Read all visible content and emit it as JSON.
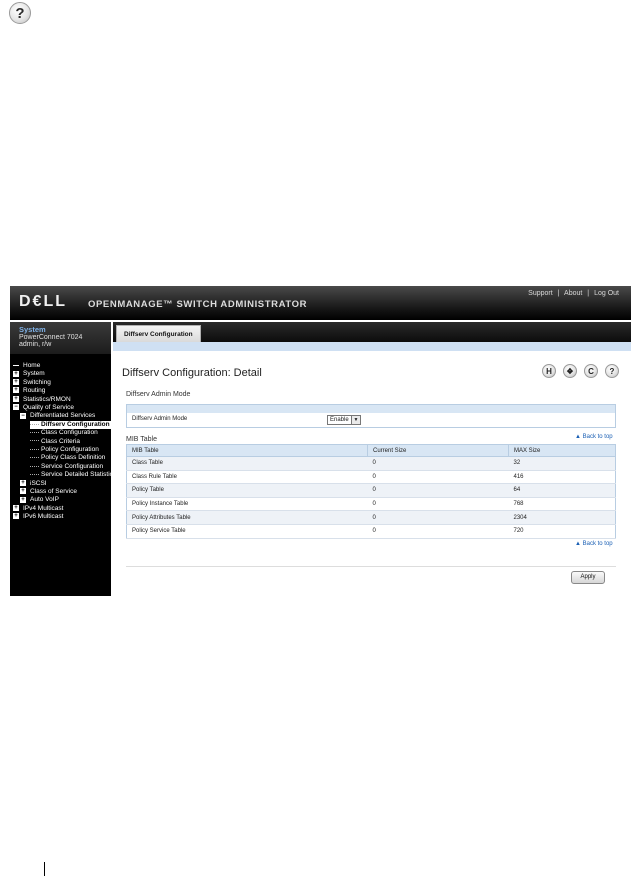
{
  "help_top": {
    "glyph": "?"
  },
  "banner": {
    "logo": "D€LL",
    "product": "OPENMANAGE™ SWITCH ADMINISTRATOR",
    "links": [
      "Support",
      "About",
      "Log Out"
    ],
    "sep": "|"
  },
  "sidebar": {
    "system_title": "System",
    "system_model": "PowerConnect 7024",
    "system_user": "admin, r/w",
    "tree": [
      {
        "label": "Home",
        "depth": 0,
        "mark": "none"
      },
      {
        "label": "System",
        "depth": 0,
        "mark": "plus"
      },
      {
        "label": "Switching",
        "depth": 0,
        "mark": "plus"
      },
      {
        "label": "Routing",
        "depth": 0,
        "mark": "plus"
      },
      {
        "label": "Statistics/RMON",
        "depth": 0,
        "mark": "plus"
      },
      {
        "label": "Quality of Service",
        "depth": 0,
        "mark": "minus"
      },
      {
        "label": "Differentiated Services",
        "depth": 1,
        "mark": "minus"
      },
      {
        "label": "Diffserv Configuration",
        "depth": 2,
        "mark": "none",
        "selected": true
      },
      {
        "label": "Class Configuration",
        "depth": 2,
        "mark": "none"
      },
      {
        "label": "Class Criteria",
        "depth": 2,
        "mark": "none"
      },
      {
        "label": "Policy Configuration",
        "depth": 2,
        "mark": "none"
      },
      {
        "label": "Policy Class Definition",
        "depth": 2,
        "mark": "none"
      },
      {
        "label": "Service Configuration",
        "depth": 2,
        "mark": "none"
      },
      {
        "label": "Service Detailed Statistics",
        "depth": 2,
        "mark": "none"
      },
      {
        "label": "iSCSI",
        "depth": 1,
        "mark": "plus"
      },
      {
        "label": "Class of Service",
        "depth": 1,
        "mark": "plus"
      },
      {
        "label": "Auto VoIP",
        "depth": 1,
        "mark": "plus"
      },
      {
        "label": "IPv4 Multicast",
        "depth": 0,
        "mark": "plus"
      },
      {
        "label": "IPv6 Multicast",
        "depth": 0,
        "mark": "plus"
      }
    ]
  },
  "main": {
    "tab_label": "Diffserv Configuration",
    "page_title": "Diffserv Configuration: Detail",
    "icons": [
      {
        "name": "save-icon",
        "glyph": "H"
      },
      {
        "name": "print-icon",
        "glyph": "❖"
      },
      {
        "name": "refresh-icon",
        "glyph": "C"
      },
      {
        "name": "help-icon",
        "glyph": "?"
      }
    ],
    "admin_section": "Diffserv Admin Mode",
    "admin_label": "Diffserv Admin Mode",
    "admin_value": "Enable",
    "mib_section": "MIB Table",
    "back_to_top": "Back to top",
    "mib_headers": [
      "MIB Table",
      "Current Size",
      "MAX Size"
    ],
    "mib_rows": [
      [
        "Class Table",
        "0",
        "32"
      ],
      [
        "Class Rule Table",
        "0",
        "416"
      ],
      [
        "Policy Table",
        "0",
        "64"
      ],
      [
        "Policy Instance Table",
        "0",
        "768"
      ],
      [
        "Policy Attributes Table",
        "0",
        "2304"
      ],
      [
        "Policy Service Table",
        "0",
        "720"
      ]
    ],
    "apply_label": "Apply"
  }
}
